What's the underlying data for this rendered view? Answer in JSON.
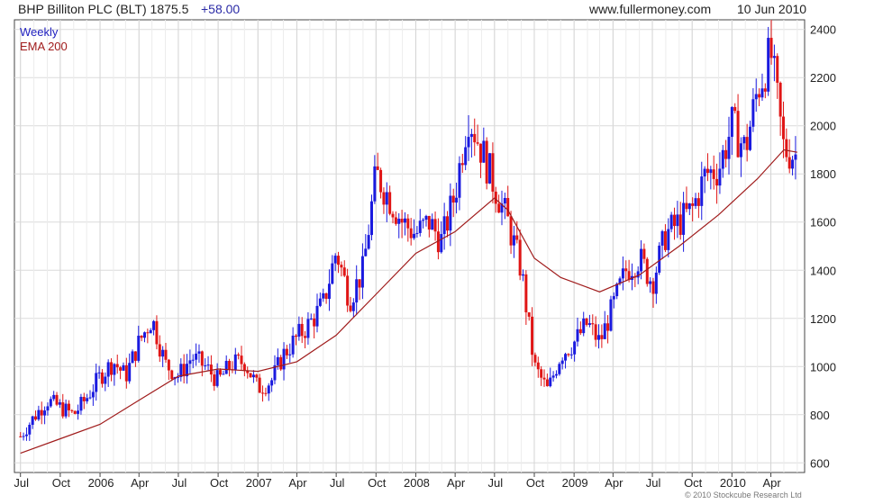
{
  "header": {
    "title": "BHP Billiton PLC (BLT) 1875.5",
    "change": "+58.00",
    "site": "www.fullermoney.com",
    "date": "10 Jun 2010"
  },
  "footer": {
    "copyright": "© 2010 Stockcube Research Ltd"
  },
  "chart_data": {
    "type": "line",
    "legend": [
      {
        "name": "Weekly",
        "color": "#1f1fbf"
      },
      {
        "name": "EMA 200",
        "color": "#a01c1c"
      }
    ],
    "up_color": "#1a1adf",
    "down_color": "#e01515",
    "ylim": [
      560,
      2440
    ],
    "y_ticks": [
      600,
      800,
      1000,
      1200,
      1400,
      1600,
      1800,
      2000,
      2200,
      2400
    ],
    "x_ticks": [
      "Jul",
      "Oct",
      "2006",
      "Apr",
      "Jul",
      "Oct",
      "2007",
      "Apr",
      "Jul",
      "Oct",
      "2008",
      "Apr",
      "Jul",
      "Oct",
      "2009",
      "Apr",
      "Jul",
      "Oct",
      "2010",
      "Apr"
    ],
    "grid": true,
    "weekly_close": [
      {
        "date": "2005-07-01",
        "value": 710
      },
      {
        "date": "2005-08-01",
        "value": 790
      },
      {
        "date": "2005-09-01",
        "value": 860
      },
      {
        "date": "2005-10-01",
        "value": 830
      },
      {
        "date": "2005-11-01",
        "value": 800
      },
      {
        "date": "2005-12-01",
        "value": 870
      },
      {
        "date": "2006-01-01",
        "value": 960
      },
      {
        "date": "2006-02-01",
        "value": 1020
      },
      {
        "date": "2006-03-01",
        "value": 960
      },
      {
        "date": "2006-04-01",
        "value": 1100
      },
      {
        "date": "2006-05-01",
        "value": 1200
      },
      {
        "date": "2006-06-01",
        "value": 1010
      },
      {
        "date": "2006-07-01",
        "value": 960
      },
      {
        "date": "2006-08-01",
        "value": 1040
      },
      {
        "date": "2006-09-01",
        "value": 1000
      },
      {
        "date": "2006-10-01",
        "value": 940
      },
      {
        "date": "2006-11-01",
        "value": 1010
      },
      {
        "date": "2006-12-01",
        "value": 1020
      },
      {
        "date": "2007-01-01",
        "value": 910
      },
      {
        "date": "2007-02-01",
        "value": 940
      },
      {
        "date": "2007-03-01",
        "value": 1050
      },
      {
        "date": "2007-04-01",
        "value": 1120
      },
      {
        "date": "2007-05-01",
        "value": 1180
      },
      {
        "date": "2007-06-01",
        "value": 1260
      },
      {
        "date": "2007-07-01",
        "value": 1480
      },
      {
        "date": "2007-08-01",
        "value": 1280
      },
      {
        "date": "2007-09-01",
        "value": 1400
      },
      {
        "date": "2007-10-01",
        "value": 1800
      },
      {
        "date": "2007-11-01",
        "value": 1700
      },
      {
        "date": "2007-12-01",
        "value": 1600
      },
      {
        "date": "2008-01-01",
        "value": 1550
      },
      {
        "date": "2008-02-01",
        "value": 1600
      },
      {
        "date": "2008-03-01",
        "value": 1520
      },
      {
        "date": "2008-04-01",
        "value": 1720
      },
      {
        "date": "2008-05-01",
        "value": 2050
      },
      {
        "date": "2008-06-01",
        "value": 1900
      },
      {
        "date": "2008-07-01",
        "value": 1750
      },
      {
        "date": "2008-08-01",
        "value": 1600
      },
      {
        "date": "2008-09-01",
        "value": 1400
      },
      {
        "date": "2008-10-01",
        "value": 1000
      },
      {
        "date": "2008-11-01",
        "value": 900
      },
      {
        "date": "2008-12-01",
        "value": 1050
      },
      {
        "date": "2009-01-01",
        "value": 1100
      },
      {
        "date": "2009-02-01",
        "value": 1180
      },
      {
        "date": "2009-03-01",
        "value": 1100
      },
      {
        "date": "2009-04-01",
        "value": 1250
      },
      {
        "date": "2009-05-01",
        "value": 1400
      },
      {
        "date": "2009-06-01",
        "value": 1450
      },
      {
        "date": "2009-07-01",
        "value": 1350
      },
      {
        "date": "2009-08-01",
        "value": 1550
      },
      {
        "date": "2009-09-01",
        "value": 1600
      },
      {
        "date": "2009-10-01",
        "value": 1650
      },
      {
        "date": "2009-11-01",
        "value": 1800
      },
      {
        "date": "2009-12-01",
        "value": 1820
      },
      {
        "date": "2010-01-01",
        "value": 2000
      },
      {
        "date": "2010-02-01",
        "value": 1900
      },
      {
        "date": "2010-03-01",
        "value": 2150
      },
      {
        "date": "2010-04-01",
        "value": 2300
      },
      {
        "date": "2010-05-01",
        "value": 1900
      },
      {
        "date": "2010-06-01",
        "value": 1875.5
      }
    ],
    "ema_200": [
      {
        "date": "2005-07-01",
        "value": 640
      },
      {
        "date": "2005-10-01",
        "value": 700
      },
      {
        "date": "2006-01-01",
        "value": 760
      },
      {
        "date": "2006-04-01",
        "value": 860
      },
      {
        "date": "2006-07-01",
        "value": 960
      },
      {
        "date": "2006-10-01",
        "value": 990
      },
      {
        "date": "2007-01-01",
        "value": 980
      },
      {
        "date": "2007-04-01",
        "value": 1020
      },
      {
        "date": "2007-07-01",
        "value": 1130
      },
      {
        "date": "2007-10-01",
        "value": 1300
      },
      {
        "date": "2008-01-01",
        "value": 1470
      },
      {
        "date": "2008-04-01",
        "value": 1560
      },
      {
        "date": "2008-07-01",
        "value": 1700
      },
      {
        "date": "2008-08-01",
        "value": 1650
      },
      {
        "date": "2008-10-01",
        "value": 1450
      },
      {
        "date": "2008-12-01",
        "value": 1370
      },
      {
        "date": "2009-03-01",
        "value": 1310
      },
      {
        "date": "2009-06-01",
        "value": 1380
      },
      {
        "date": "2009-09-01",
        "value": 1500
      },
      {
        "date": "2009-12-01",
        "value": 1630
      },
      {
        "date": "2010-03-01",
        "value": 1780
      },
      {
        "date": "2010-05-01",
        "value": 1900
      },
      {
        "date": "2010-06-01",
        "value": 1890
      }
    ]
  }
}
